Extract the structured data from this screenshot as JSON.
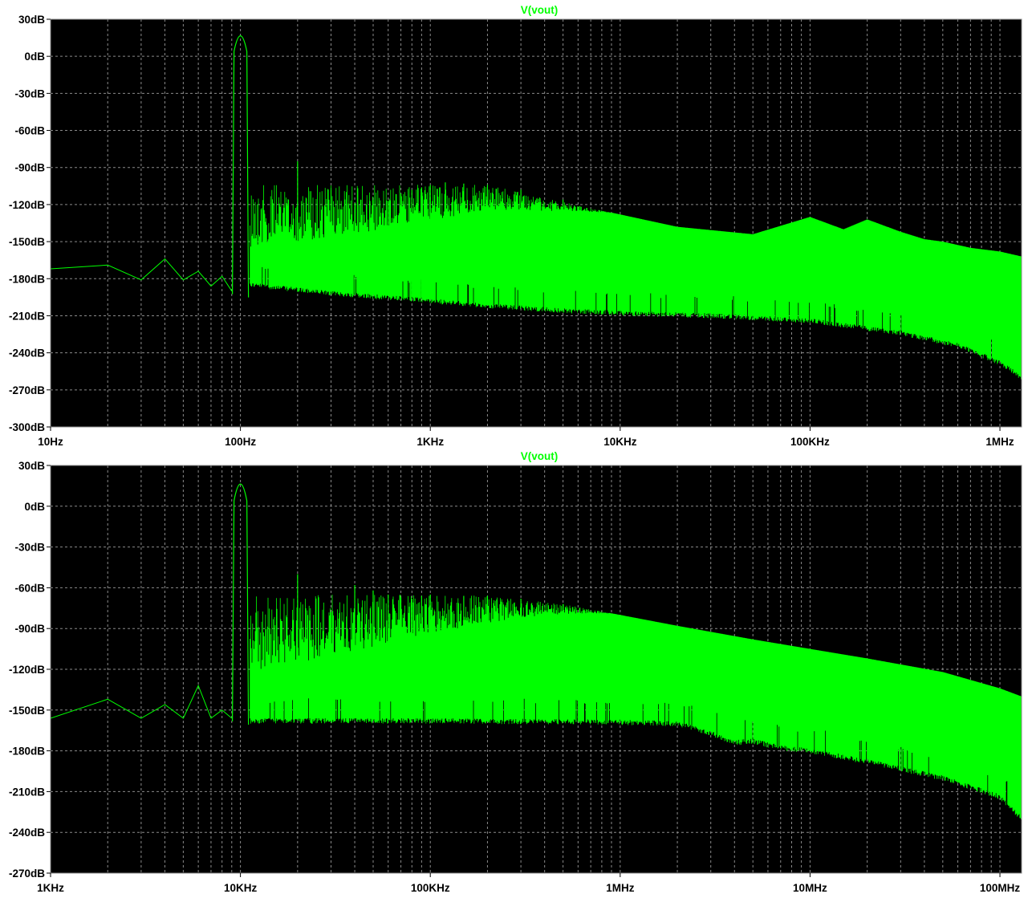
{
  "colors": {
    "background": "#ffffff",
    "plot_area": "#000000",
    "grid": "#8a8a8a",
    "trace": "#00ff00",
    "tick_text": "#000000"
  },
  "chart_data": [
    {
      "type": "line",
      "title": "V(vout)",
      "xscale": "log",
      "xlim": [
        10,
        1300000
      ],
      "ylim": [
        -300,
        30
      ],
      "grid": true,
      "legend": "none",
      "x_ticks": [
        10,
        100,
        1000,
        10000,
        100000,
        1000000
      ],
      "x_tick_labels": [
        "10Hz",
        "100Hz",
        "1KHz",
        "10KHz",
        "100KHz",
        "1MHz"
      ],
      "y_ticks": [
        30,
        0,
        -30,
        -60,
        -90,
        -120,
        -150,
        -180,
        -210,
        -240,
        -270,
        -300
      ],
      "y_tick_labels": [
        "30dB",
        "0dB",
        "-30dB",
        "-60dB",
        "-90dB",
        "-120dB",
        "-150dB",
        "-180dB",
        "-210dB",
        "-240dB",
        "-270dB",
        "-300dB"
      ],
      "fundamental": {
        "x": 100,
        "y": 24
      },
      "baseline_low_freq": {
        "x": [
          10,
          20,
          30,
          40,
          50,
          60,
          70,
          80,
          90
        ],
        "y": [
          -172,
          -169,
          -181,
          -164,
          -181,
          -174,
          -186,
          -178,
          -190
        ]
      },
      "harmonics": {
        "x": [
          200,
          300,
          400,
          500,
          600,
          700,
          800,
          900,
          1000,
          1200,
          1500,
          2000,
          3000,
          5000,
          10000,
          20000
        ],
        "y": [
          -85,
          -108,
          -124,
          -132,
          -117,
          -111,
          -108,
          -106,
          -104,
          -102,
          -103,
          -104,
          -108,
          -116,
          -128,
          -140
        ]
      },
      "upper_envelope": {
        "x": [
          1000,
          2000,
          3000,
          5000,
          10000,
          20000,
          50000,
          100000,
          150000,
          200000,
          300000,
          400000,
          500000,
          700000,
          1000000,
          1300000
        ],
        "y": [
          -104,
          -104,
          -110,
          -118,
          -128,
          -138,
          -144,
          -130,
          -140,
          -132,
          -142,
          -148,
          -150,
          -155,
          -158,
          -162
        ]
      },
      "lower_envelope": {
        "x": [
          100,
          300,
          1000,
          2000,
          5000,
          10000,
          30000,
          100000,
          300000,
          600000,
          1000000,
          1300000
        ],
        "y": [
          -182,
          -190,
          -196,
          -200,
          -204,
          -206,
          -208,
          -212,
          -222,
          -232,
          -246,
          -258
        ]
      }
    },
    {
      "type": "line",
      "title": "V(vout)",
      "xscale": "log",
      "xlim": [
        1000,
        130000000
      ],
      "ylim": [
        -270,
        30
      ],
      "grid": true,
      "legend": "none",
      "x_ticks": [
        1000,
        10000,
        100000,
        1000000,
        10000000,
        100000000
      ],
      "x_tick_labels": [
        "1KHz",
        "10KHz",
        "100KHz",
        "1MHz",
        "10MHz",
        "100MHz"
      ],
      "y_ticks": [
        30,
        0,
        -30,
        -60,
        -90,
        -120,
        -150,
        -180,
        -210,
        -240,
        -270
      ],
      "y_tick_labels": [
        "30dB",
        "0dB",
        "-30dB",
        "-60dB",
        "-90dB",
        "-120dB",
        "-150dB",
        "-180dB",
        "-210dB",
        "-240dB",
        "-270dB"
      ],
      "fundamental": {
        "x": 10000,
        "y": 24
      },
      "baseline_low_freq": {
        "x": [
          1000,
          2000,
          3000,
          4000,
          5000,
          6000,
          7000,
          8000,
          9000
        ],
        "y": [
          -156,
          -142,
          -156,
          -146,
          -156,
          -132,
          -156,
          -150,
          -156
        ]
      },
      "harmonics": {
        "x": [
          20000,
          30000,
          40000,
          50000,
          60000,
          70000,
          80000,
          90000,
          100000,
          150000,
          200000,
          300000,
          500000,
          1000000
        ],
        "y": [
          -50,
          -78,
          -58,
          -62,
          -65,
          -67,
          -68,
          -66,
          -65,
          -66,
          -66,
          -68,
          -72,
          -80
        ]
      },
      "upper_envelope": {
        "x": [
          100000,
          200000,
          500000,
          1000000,
          2000000,
          5000000,
          10000000,
          20000000,
          50000000,
          100000000,
          130000000
        ],
        "y": [
          -65,
          -66,
          -72,
          -80,
          -88,
          -98,
          -105,
          -112,
          -122,
          -134,
          -140
        ]
      },
      "lower_envelope": {
        "x": [
          10000,
          100000,
          1000000,
          2000000,
          3000000,
          4000000,
          5000000,
          7000000,
          10000000,
          20000000,
          50000000,
          100000000,
          130000000
        ],
        "y": [
          -156,
          -156,
          -157,
          -158,
          -165,
          -172,
          -171,
          -176,
          -178,
          -186,
          -198,
          -212,
          -228
        ]
      }
    }
  ]
}
